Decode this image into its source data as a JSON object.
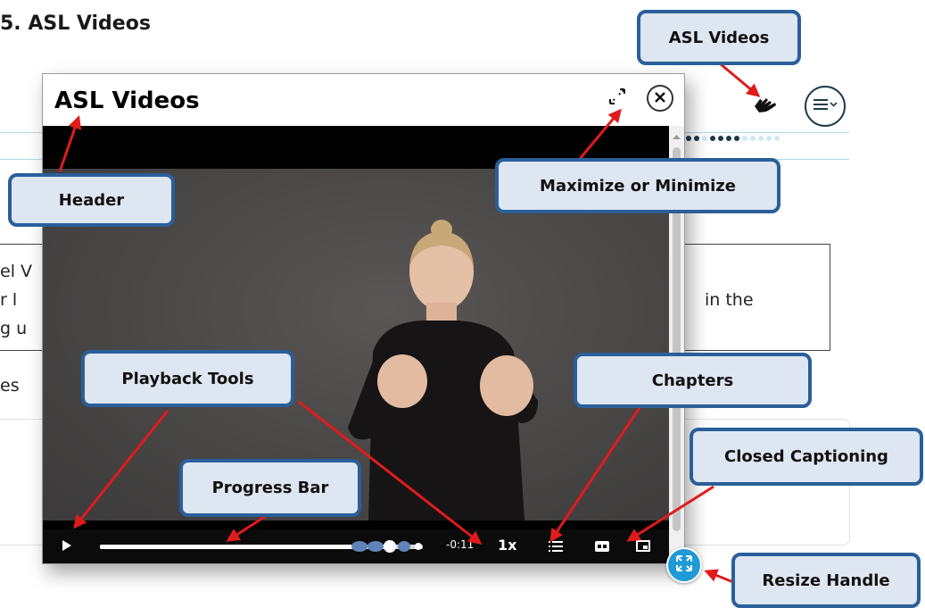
{
  "page": {
    "section_title": "5. ASL Videos",
    "bg_text": [
      "el V",
      "r l",
      "g u",
      "in the",
      "es"
    ]
  },
  "panel": {
    "title": "ASL Videos",
    "controls": {
      "time_remaining": "-0:11",
      "speed": "1x",
      "progress": 0.8
    }
  },
  "callouts": {
    "asl_videos": "ASL Videos",
    "header": "Header",
    "maximize": "Maximize or Minimize",
    "playback": "Playback Tools",
    "chapters": "Chapters",
    "closed_captioning": "Closed Captioning",
    "progress_bar": "Progress Bar",
    "resize_handle": "Resize Handle"
  },
  "icons": [
    "asl-sign-icon",
    "hamburger-menu-icon",
    "maximize-icon",
    "close-icon",
    "play-icon",
    "chapters-list-icon",
    "closed-caption-icon",
    "picture-in-picture-icon",
    "resize-icon"
  ],
  "colors": {
    "callout_border": "#2a5f99",
    "callout_fill": "#dde6f1",
    "arrow": "#e01b1b",
    "resize_handle": "#1f9ad6"
  }
}
